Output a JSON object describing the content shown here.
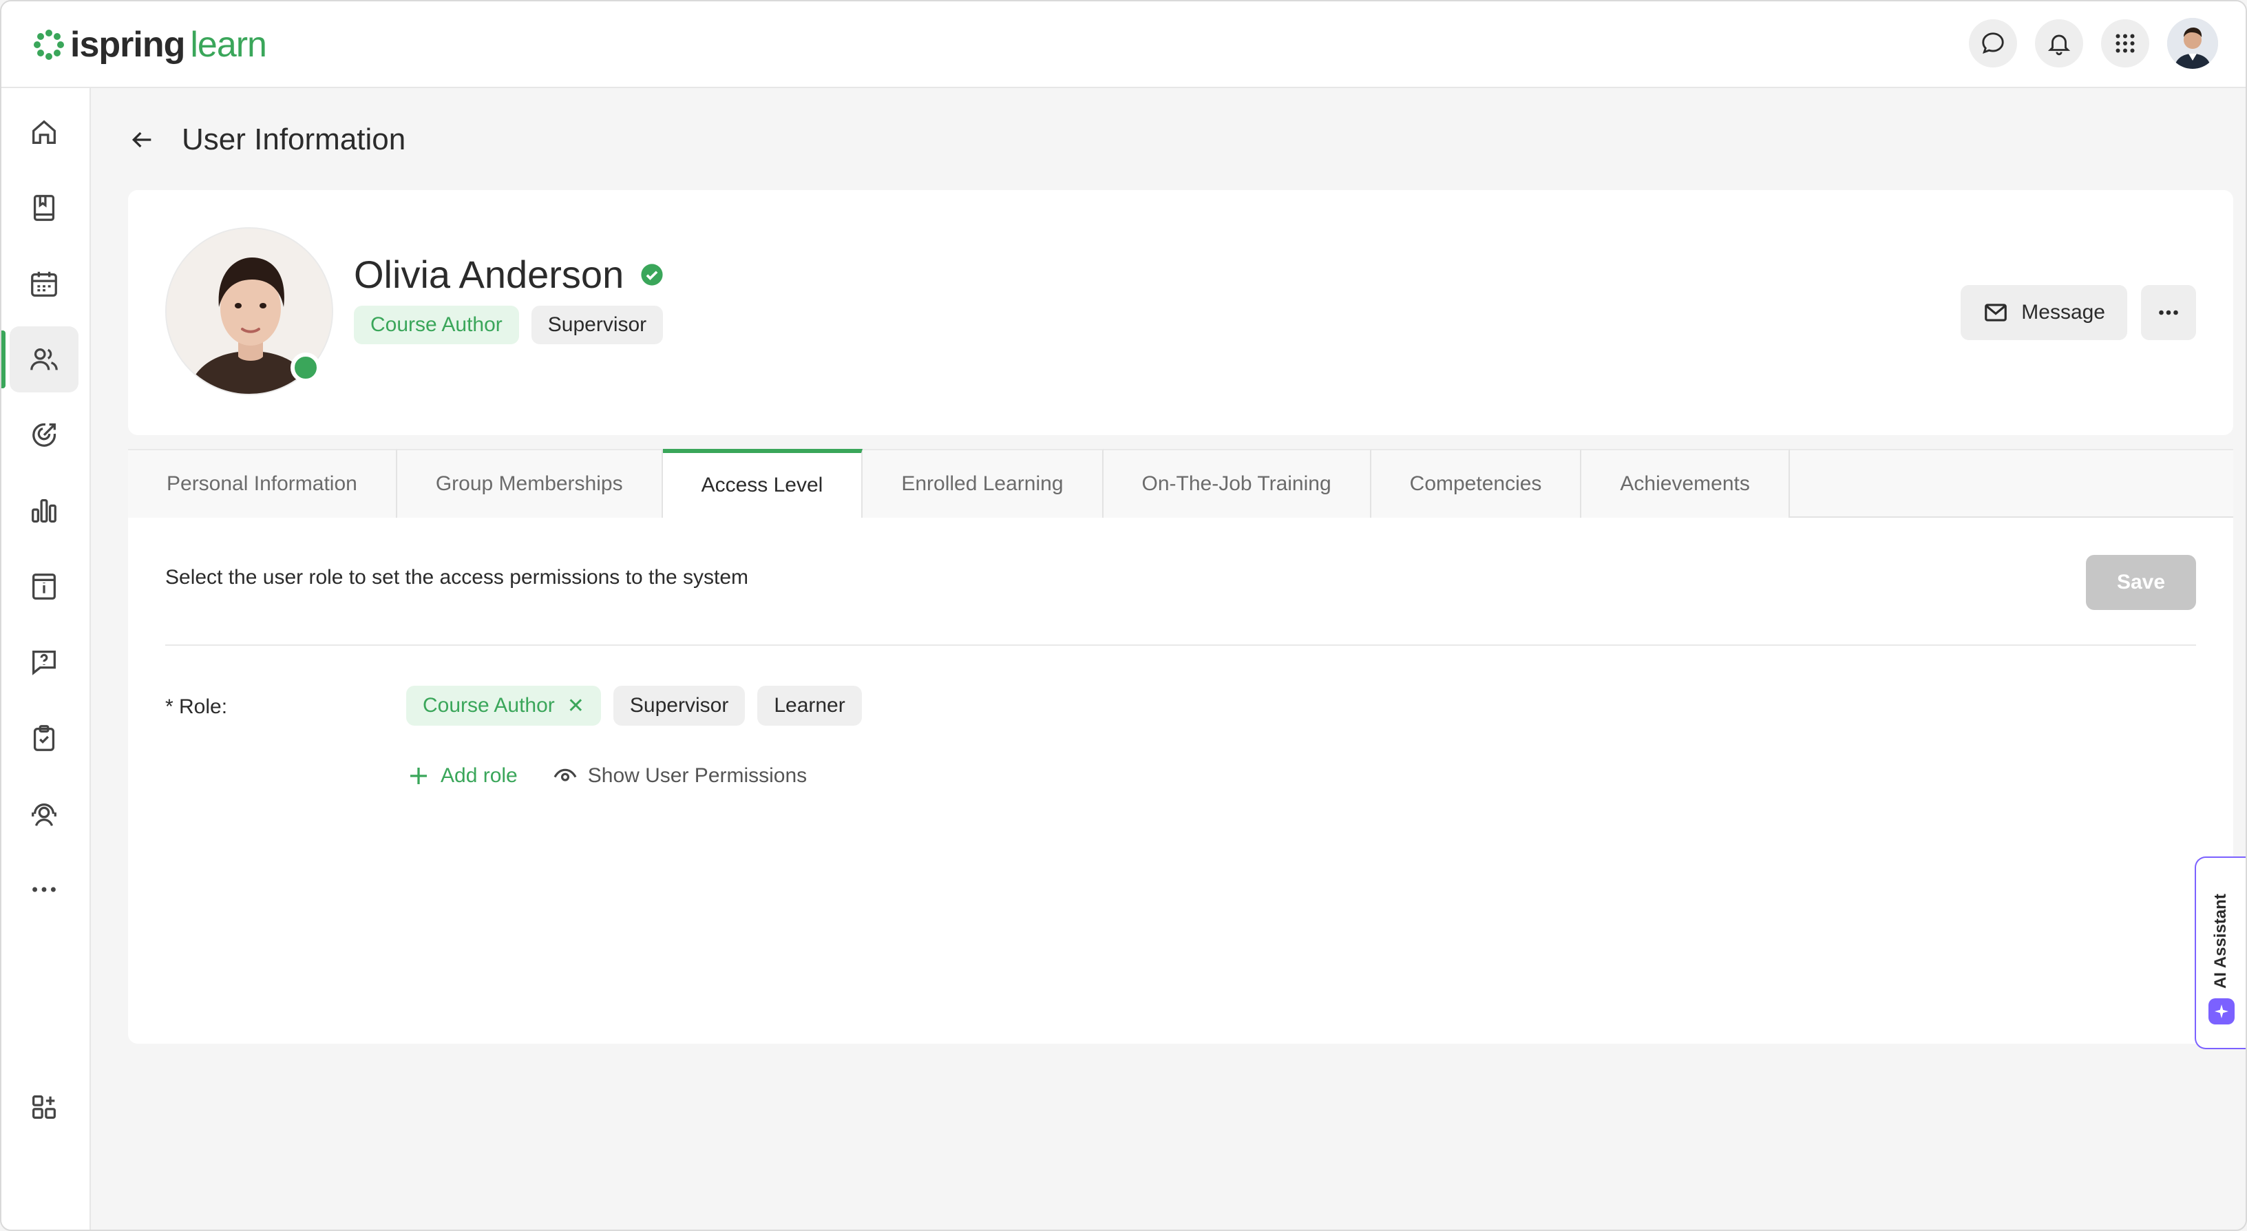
{
  "brand": {
    "name_part1": "ispring",
    "name_part2": "learn",
    "accent": "#3aa65a"
  },
  "topbar": {
    "icons": [
      "chat-icon",
      "bell-icon",
      "apps-grid-icon",
      "user-avatar"
    ]
  },
  "sidebar": {
    "items": [
      {
        "icon": "home-icon"
      },
      {
        "icon": "book-icon"
      },
      {
        "icon": "calendar-icon"
      },
      {
        "icon": "users-icon",
        "active": true
      },
      {
        "icon": "target-icon"
      },
      {
        "icon": "bar-chart-icon"
      },
      {
        "icon": "info-card-icon"
      },
      {
        "icon": "help-chat-icon"
      },
      {
        "icon": "clipboard-check-icon"
      },
      {
        "icon": "support-agent-icon"
      },
      {
        "icon": "more-icon"
      },
      {
        "icon": "add-widget-icon"
      }
    ]
  },
  "page": {
    "title": "User Information"
  },
  "profile": {
    "name": "Olivia Anderson",
    "roles": [
      "Course Author",
      "Supervisor"
    ],
    "message_label": "Message"
  },
  "tabs": [
    {
      "label": "Personal Information"
    },
    {
      "label": "Group Memberships"
    },
    {
      "label": "Access Level",
      "active": true
    },
    {
      "label": "Enrolled Learning"
    },
    {
      "label": "On-The-Job Training"
    },
    {
      "label": "Competencies"
    },
    {
      "label": "Achievements"
    }
  ],
  "access": {
    "hint": "Select the user role to set the access permissions to the system",
    "save_label": "Save",
    "role_label": "* Role:",
    "roles": [
      "Course Author",
      "Supervisor",
      "Learner"
    ],
    "add_role": "Add role",
    "show_permissions": "Show User Permissions"
  },
  "assistant": {
    "label": "AI Assistant",
    "color": "#7b61ff"
  }
}
